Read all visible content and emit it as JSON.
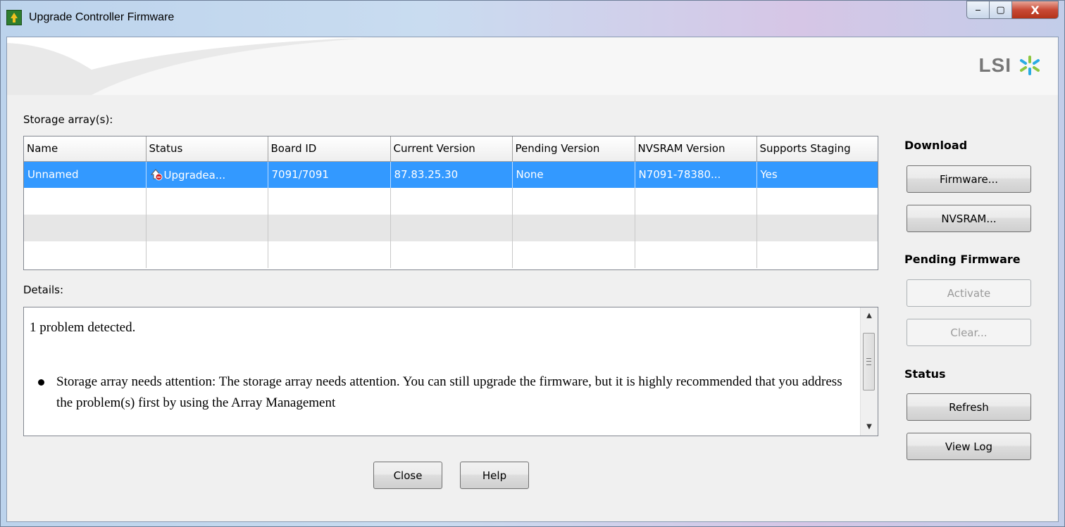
{
  "window": {
    "title": "Upgrade Controller Firmware",
    "controls": {
      "minimize": "‒",
      "maximize": "▢",
      "close": "X"
    }
  },
  "branding": {
    "logo_text": "LSI"
  },
  "storage": {
    "label": "Storage array(s):",
    "columns": [
      "Name",
      "Status",
      "Board ID",
      "Current Version",
      "Pending Version",
      "NVSRAM Version",
      "Supports Staging"
    ],
    "rows": [
      {
        "name": "Unnamed",
        "status": "Upgradea...",
        "board_id": "7091/7091",
        "current_version": "87.83.25.30",
        "pending_version": "None",
        "nvsram_version": "N7091-78380...",
        "supports_staging": "Yes",
        "selected": true
      }
    ]
  },
  "details": {
    "label": "Details:",
    "summary": "1 problem detected.",
    "problems": [
      "Storage array needs attention: The storage array needs attention. You can still upgrade the firmware, but it is highly recommended that you address the problem(s) first by using the Array Management"
    ]
  },
  "side_panel": {
    "download": {
      "heading": "Download",
      "firmware_button": "Firmware...",
      "nvsram_button": "NVSRAM..."
    },
    "pending": {
      "heading": "Pending Firmware",
      "activate_button": "Activate",
      "clear_button": "Clear..."
    },
    "status": {
      "heading": "Status",
      "refresh_button": "Refresh",
      "view_log_button": "View Log"
    }
  },
  "footer": {
    "close_button": "Close",
    "help_button": "Help"
  },
  "colors": {
    "selection": "#3399ff",
    "close_button": "#c94a35",
    "app_icon": "#2e7d2e"
  }
}
